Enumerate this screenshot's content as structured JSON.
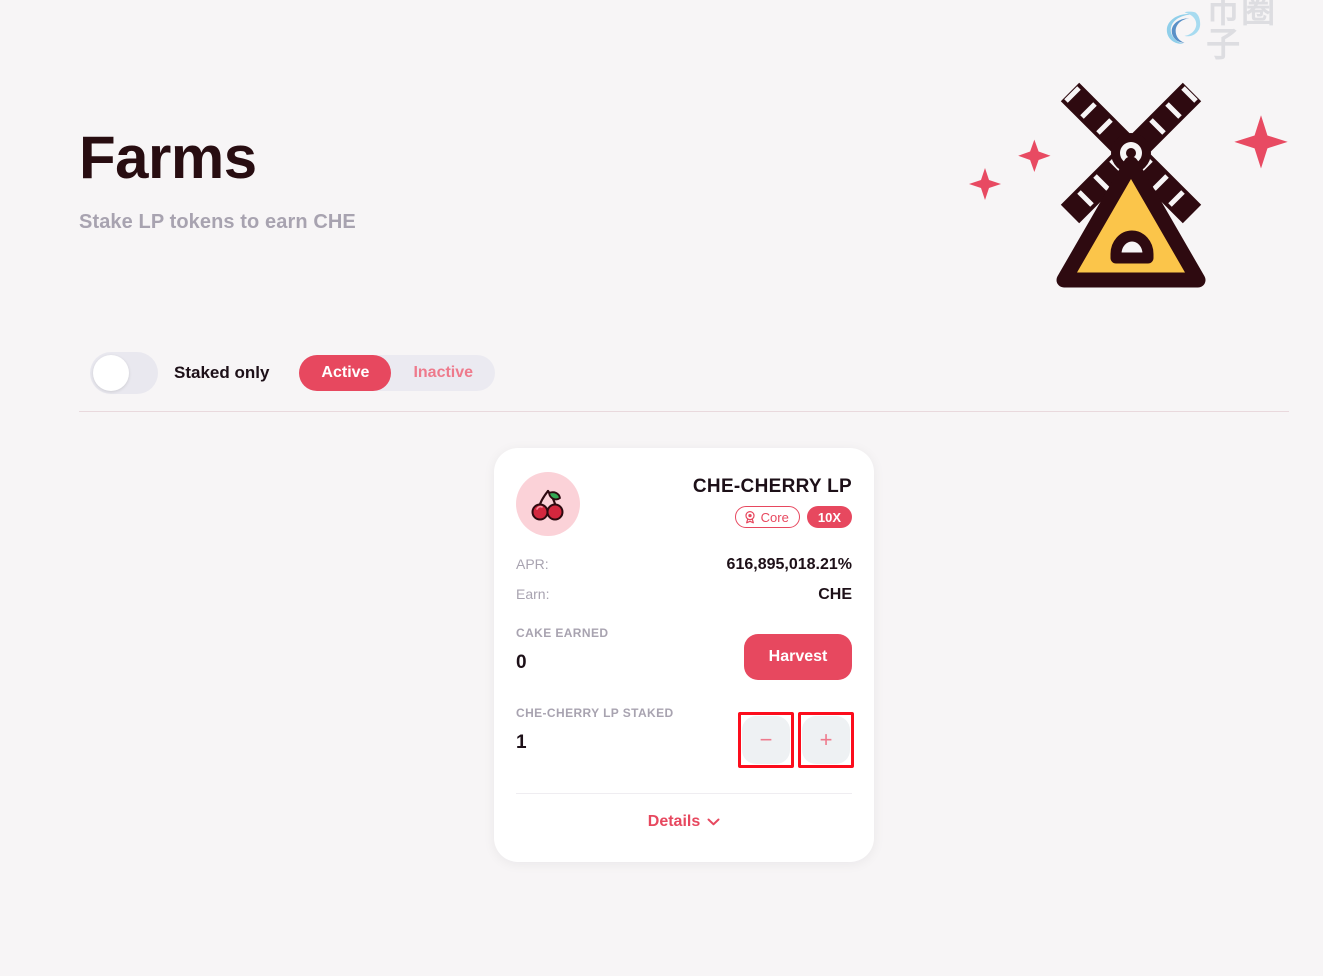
{
  "watermark": {
    "text": "币圈子",
    "icon": "swirl-logo-icon"
  },
  "header": {
    "title": "Farms",
    "subtitle": "Stake LP tokens to earn CHE",
    "illustration": "windmill-illustration"
  },
  "controls": {
    "staked_only_label": "Staked only",
    "staked_only_state": "off",
    "tabs": [
      {
        "label": "Active",
        "selected": true
      },
      {
        "label": "Inactive",
        "selected": false
      }
    ]
  },
  "farm_card": {
    "token_icon": "cherry-icon",
    "pair_name": "CHE-CHERRY LP",
    "badges": {
      "core_label": "Core",
      "core_icon": "core-ribbon-icon",
      "multiplier_label": "10X"
    },
    "apr_label": "APR:",
    "apr_value": "616,895,018.21%",
    "earn_label": "Earn:",
    "earn_value": "CHE",
    "earned_label": "CAKE EARNED",
    "earned_value": "0",
    "harvest_label": "Harvest",
    "staked_label": "CHE-CHERRY LP STAKED",
    "staked_value": "1",
    "minus_label": "−",
    "plus_label": "+",
    "details_label": "Details",
    "details_chevron": "chevron-down-icon"
  },
  "colors": {
    "background": "#F7F5F6",
    "accent": "#E7485F",
    "accent_light": "#EE7A8C",
    "title": "#280D11",
    "muted": "#A8A3B0",
    "card": "#FFFFFF",
    "highlight_box": "#FC0D1C",
    "windmill_body": "#FBC54A",
    "windmill_frame": "#2E0A10"
  }
}
